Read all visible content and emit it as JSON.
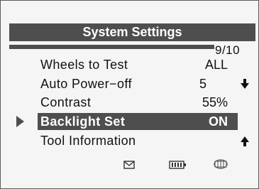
{
  "screen": {
    "title": "System Settings",
    "page_indicator": "9/10"
  },
  "menu": {
    "items": [
      {
        "label": "Wheels to Test",
        "value": "ALL"
      },
      {
        "label": "Auto Power−off",
        "value": "5"
      },
      {
        "label": "Contrast",
        "value": "55%"
      },
      {
        "label": "Backlight Set",
        "value": "ON"
      },
      {
        "label": "Tool Information",
        "value": ""
      }
    ],
    "selected_index": 3
  },
  "status_bar": {
    "icons": [
      "message-icon",
      "battery-icon",
      "tire-icon"
    ]
  },
  "icons": {
    "scroll_down": "arrow-down-icon",
    "scroll_up": "arrow-up-icon",
    "selection_pointer": "triangle-pointer-icon"
  },
  "colors": {
    "highlight": "#4e4e4e",
    "text": "#111111",
    "highlight_text": "#ffffff",
    "background": "#f5f5f5"
  }
}
